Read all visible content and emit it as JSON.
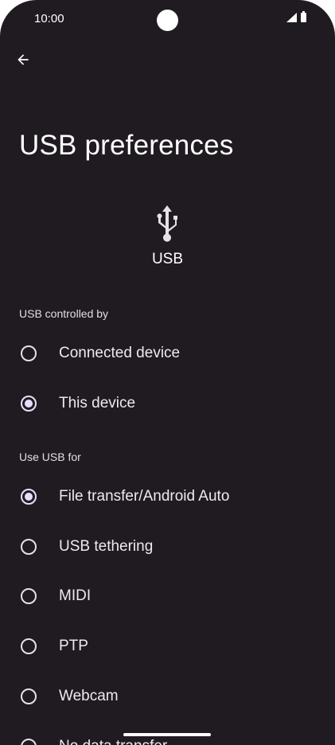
{
  "status_bar": {
    "time": "10:00",
    "icons": [
      "camera-cutout",
      "signal-icon",
      "battery-icon"
    ]
  },
  "header": {
    "back_icon": "arrow-back-icon",
    "title": "USB preferences"
  },
  "device": {
    "icon": "usb-icon",
    "label": "USB"
  },
  "controlled_by": {
    "header": "USB controlled by",
    "options": [
      {
        "label": "Connected device",
        "selected": false
      },
      {
        "label": "This device",
        "selected": true
      }
    ]
  },
  "use_for": {
    "header": "Use USB for",
    "options": [
      {
        "label": "File transfer/Android Auto",
        "selected": true
      },
      {
        "label": "USB tethering",
        "selected": false
      },
      {
        "label": "MIDI",
        "selected": false
      },
      {
        "label": "PTP",
        "selected": false
      },
      {
        "label": "Webcam",
        "selected": false
      },
      {
        "label": "No data transfer",
        "selected": false
      }
    ]
  },
  "colors": {
    "background": "#1f1b20",
    "accent": "#e8defc",
    "text": "#efe9f0"
  }
}
